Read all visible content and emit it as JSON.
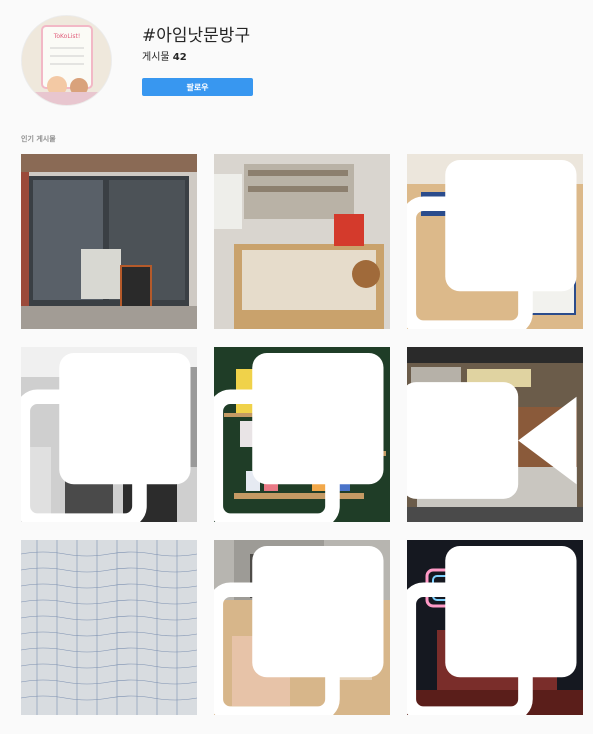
{
  "hashtag": {
    "title": "#아임낫문방구",
    "posts_label": "게시물",
    "posts_count": "42",
    "follow_label": "팔로우"
  },
  "avatar": {
    "sign_text": "ToKoList!"
  },
  "top_posts": {
    "label": "인기 게시물"
  },
  "posts": [
    {
      "badge": "none"
    },
    {
      "badge": "none"
    },
    {
      "badge": "carousel-icon"
    },
    {
      "badge": "carousel-icon"
    },
    {
      "badge": "carousel-icon"
    },
    {
      "badge": "video-icon"
    },
    {
      "badge": "none"
    },
    {
      "badge": "carousel-icon"
    },
    {
      "badge": "carousel-icon"
    }
  ],
  "colors": {
    "accent": "#3897f0",
    "background": "#fafafa",
    "muted_text": "#8e8e8e"
  }
}
